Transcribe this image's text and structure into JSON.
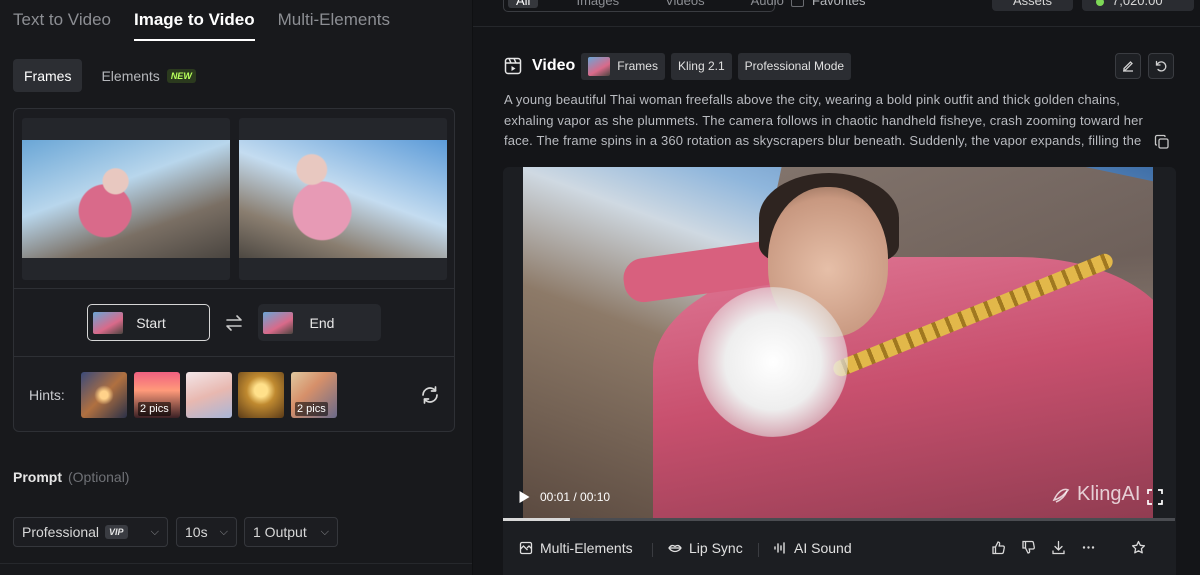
{
  "mode_tabs": [
    {
      "label": "Text to Video"
    },
    {
      "label": "Image to Video"
    },
    {
      "label": "Multi-Elements"
    }
  ],
  "sub_tabs": {
    "frames": "Frames",
    "elements": "Elements",
    "elements_badge": "NEW"
  },
  "frames": {
    "start_label": "Start",
    "end_label": "End"
  },
  "hints": {
    "label": "Hints:",
    "items": [
      {
        "count": ""
      },
      {
        "count": "2 pics"
      },
      {
        "count": ""
      },
      {
        "count": ""
      },
      {
        "count": "2 pics"
      }
    ]
  },
  "prompt": {
    "label": "Prompt",
    "optional": "(Optional)"
  },
  "settings": {
    "quality": "Professional",
    "quality_badge": "VIP",
    "duration": "10s",
    "outputs": "1 Output"
  },
  "top_strip": {
    "filters": [
      "All",
      "Images",
      "Videos",
      "Audio"
    ],
    "favorites": "Favorites",
    "assets": "Assets",
    "credits": "7,020.00"
  },
  "video": {
    "title": "Video",
    "chips": [
      "Frames",
      "Kling 2.1",
      "Professional Mode"
    ],
    "description": "A young beautiful Thai woman freefalls above the city, wearing a bold pink outfit and thick golden chains, exhaling vapor as she plummets. The camera follows in chaotic handheld fisheye, crash zooming toward her face. The frame spins in a 360 rotation as skyscrapers blur beneath. Suddenly, the vapor expands, filling the",
    "time_current": "00:01",
    "time_total": "00:10",
    "watermark": "KlingAI",
    "progress": 0.1
  },
  "actions": {
    "multi_elements": "Multi-Elements",
    "lip_sync": "Lip Sync",
    "ai_sound": "AI Sound"
  }
}
